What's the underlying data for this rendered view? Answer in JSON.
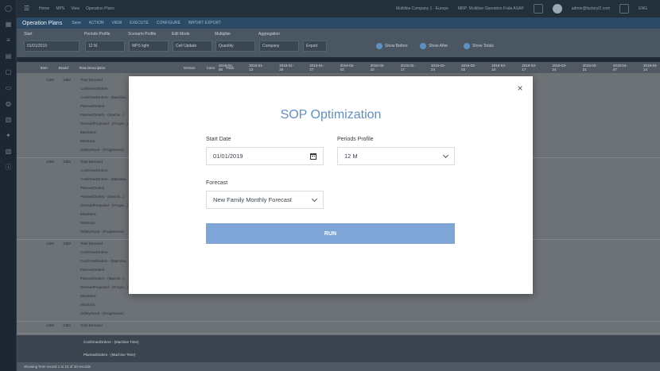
{
  "topbar": {
    "crumbs": [
      "Home",
      "MPS",
      "View",
      "Operation Plans"
    ],
    "company": "Multiline Company 1 - Europe",
    "mrp": "MRP: Multiline Operation Frida ASAP",
    "user": "admin@factoryl2.com",
    "lang": "ENG"
  },
  "subhead": {
    "title": "Operation Plans",
    "menu": [
      "Save",
      "ACTION",
      "VIEW",
      "EXECUTE",
      "CONFIGURE",
      "IMPORT EXPORT"
    ]
  },
  "filters": {
    "labels": [
      "Start",
      "Periods Profile",
      "Scenario Profile",
      "Edit Mode",
      "Multiplier",
      "Aggregation"
    ],
    "values": [
      "01/01/2019",
      "12 M",
      "MPS light",
      "Cell Update",
      "Quantity",
      "Company",
      "Export"
    ],
    "toggles": [
      "Show Before",
      "Show After",
      "Show Totals"
    ]
  },
  "grid": {
    "headers": [
      "Item",
      "Brand",
      "Row Description",
      "Version",
      "Color",
      "Pack"
    ],
    "dates": [
      "2019-01-06",
      "2019-01-13",
      "2019-01-20",
      "2019-01-27",
      "2019-02-03",
      "2019-02-10",
      "2019-02-17",
      "2019-02-24",
      "2019-03-03",
      "2019-03-10",
      "2019-03-17",
      "2019-03-24",
      "2019-03-31",
      "2019-04-07",
      "2019-04-14"
    ],
    "groups": [
      {
        "item": "1380",
        "brand": "1380",
        "rows": [
          "Total Demand",
          "ConfirmedOrders",
          "ConfirmedOrders - (Machine...)",
          "PlannedOrders",
          "PlannedOrders - (Machin...)",
          "OnHandProjected - (Progre...)",
          "MaxStock",
          "MinStock",
          "SafetyStock - (Progressive)"
        ]
      },
      {
        "item": "1380",
        "brand": "1380",
        "rows": [
          "Total Demand",
          "ConfirmedOrders",
          "ConfirmedOrders - (Machine...)",
          "PlannedOrders",
          "PlannedOrders - (Machin...)",
          "OnHandProjected - (Progre...)",
          "MaxStock",
          "MinStock",
          "SafetyStock - (Progressive)"
        ]
      },
      {
        "item": "1380",
        "brand": "1380",
        "rows": [
          "Total Demand",
          "ConfirmedOrders",
          "ConfirmedOrders - (Machine...)",
          "PlannedOrders",
          "PlannedOrders - (Machin...)",
          "OnHandProjected - (Progre...)",
          "MaxStock",
          "MinStock",
          "SafetyStock - (Progressive)"
        ]
      },
      {
        "item": "1380",
        "brand": "1380",
        "rows": [
          "Total Demand"
        ]
      }
    ],
    "footer_rows": [
      "ConfirmedOrders - (Machine Time)",
      "PlannedOrders - (Machine Time)"
    ],
    "status": "Showing from record 1 to 10 of 30 records"
  },
  "modal": {
    "title": "SOP Optimization",
    "start_date_label": "Start Date",
    "start_date_value": "01/01/2019",
    "periods_label": "Periods Profile",
    "periods_value": "12 M",
    "forecast_label": "Forecast",
    "forecast_value": "New Family Monthly Forecast",
    "run_label": "RUN",
    "close_glyph": "×"
  },
  "colors": {
    "accent": "#5f8fc4",
    "run_button": "#7ea5d6",
    "subhead": "#2c4a66"
  }
}
